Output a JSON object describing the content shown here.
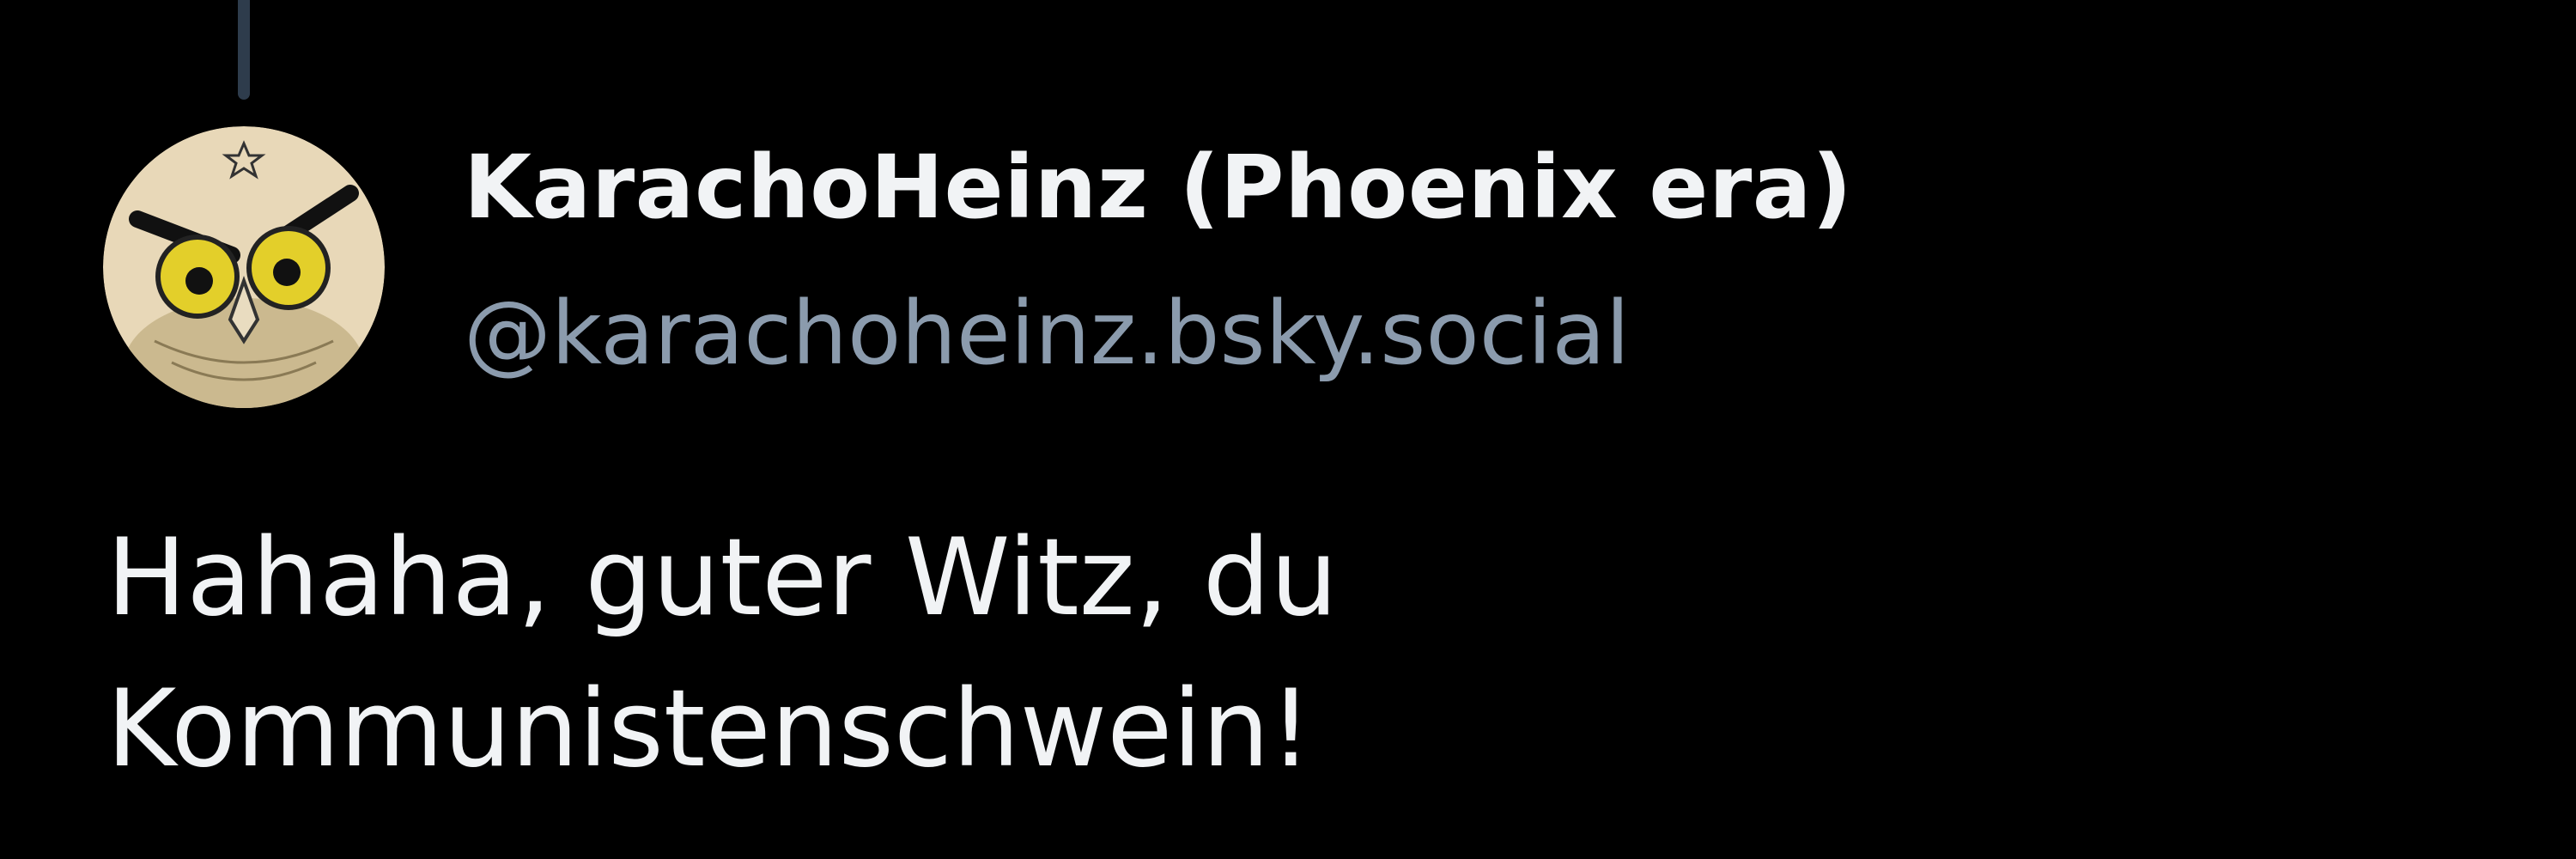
{
  "post": {
    "author": {
      "display_name": "KarachoHeinz (Phoenix era)",
      "handle": "@karachoheinz.bsky.social",
      "avatar_icon": "angry-owl-avatar"
    },
    "text_lines": [
      "Hahaha, guter Witz, du",
      "Kommunistenschwein!"
    ]
  },
  "colors": {
    "background": "#000000",
    "text_primary": "#f1f3f5",
    "text_secondary": "#8b9bad",
    "thread_line": "#2e3c4c"
  }
}
